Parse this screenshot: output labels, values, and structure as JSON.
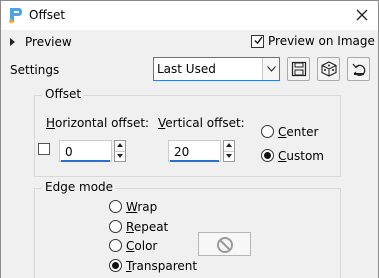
{
  "window": {
    "title": "Offset",
    "accent_color": "#2d6fd1"
  },
  "toolbar": {
    "preview_label": "Preview",
    "preview_on_image_label": "Preview on Image",
    "preview_on_image_checked": true,
    "settings_label": "Settings",
    "settings_value": "Last Used",
    "icons": [
      "save-icon",
      "randomize-dice-icon",
      "reset-icon"
    ]
  },
  "offset": {
    "group_title": "Offset",
    "horizontal_label_first": "H",
    "horizontal_label_rest": "orizontal offset:",
    "horizontal_value": "0",
    "vertical_label_first": "V",
    "vertical_label_rest": "ertical offset:",
    "vertical_value": "20",
    "center_label_first": "C",
    "center_label_rest": "enter",
    "custom_label_first": "C",
    "custom_label_rest": "ustom",
    "selected": "Custom"
  },
  "edge_mode": {
    "group_title": "Edge mode",
    "options": [
      {
        "first": "W",
        "rest": "rap"
      },
      {
        "first": "R",
        "rest": "epeat"
      },
      {
        "first": "C",
        "rest": "olor"
      },
      {
        "first": "T",
        "rest": "ransparent"
      }
    ],
    "selected": "Transparent"
  }
}
